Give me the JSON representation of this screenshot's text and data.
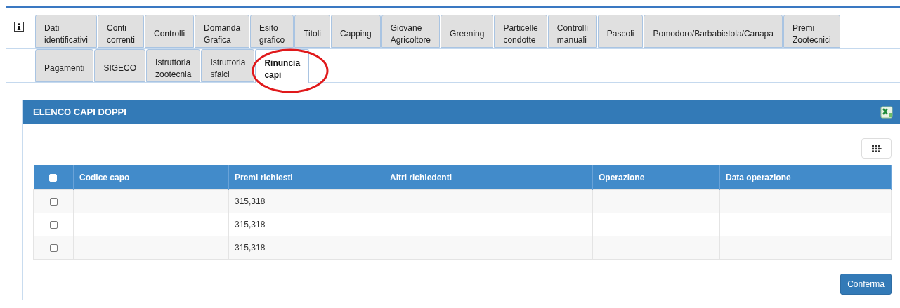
{
  "tab_rows": [
    [
      {
        "label": "Dati identificativi",
        "selected": false
      },
      {
        "label": "Conti correnti",
        "selected": false
      },
      {
        "label": "Controlli",
        "selected": false
      },
      {
        "label": "Domanda Grafica",
        "selected": false
      },
      {
        "label": "Esito grafico",
        "selected": false
      },
      {
        "label": "Titoli",
        "selected": false
      },
      {
        "label": "Capping",
        "selected": false
      },
      {
        "label": "Giovane Agricoltore",
        "selected": false
      },
      {
        "label": "Greening",
        "selected": false
      },
      {
        "label": "Particelle condotte",
        "selected": false
      },
      {
        "label": "Controlli manuali",
        "selected": false
      },
      {
        "label": "Pascoli",
        "selected": false
      },
      {
        "label": "Pomodoro/Barbabietola/Canapa",
        "selected": false
      },
      {
        "label": "Premi Zootecnici",
        "selected": false
      }
    ],
    [
      {
        "label": "Pagamenti",
        "selected": false
      },
      {
        "label": "SIGECO",
        "selected": false
      },
      {
        "label": "Istruttoria zootecnia",
        "selected": false
      },
      {
        "label": "Istruttoria sfalci",
        "selected": false
      },
      {
        "label": "Rinuncia capi",
        "selected": true
      }
    ]
  ],
  "panel": {
    "title": "ELENCO CAPI DOPPI",
    "table": {
      "select_all_checked": false,
      "columns": [
        "Codice capo",
        "Premi richiesti",
        "Altri richiedenti",
        "Operazione",
        "Data operazione"
      ],
      "rows": [
        {
          "checked": false,
          "cells": [
            "",
            "315,318",
            "",
            "",
            ""
          ]
        },
        {
          "checked": false,
          "cells": [
            "",
            "315,318",
            "",
            "",
            ""
          ]
        },
        {
          "checked": false,
          "cells": [
            "",
            "315,318",
            "",
            "",
            ""
          ]
        }
      ]
    },
    "confirm_button": "Conferma"
  }
}
